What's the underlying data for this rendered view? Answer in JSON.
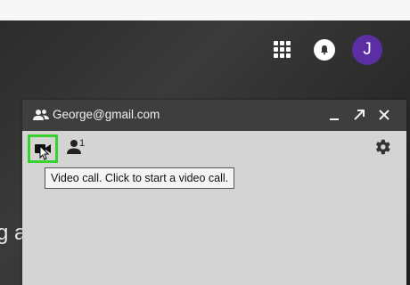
{
  "background": {
    "partial_text": "g a"
  },
  "header_icons": {
    "apps": "apps-grid-icon",
    "notifications": "bell-icon",
    "avatar_letter": "J",
    "avatar_color": "#5b2fa3"
  },
  "chat_window": {
    "title": "George@gmail.com",
    "participant_count": "1",
    "tooltip": "Video call. Click to start a video call.",
    "highlight_color": "#3ad12e"
  }
}
